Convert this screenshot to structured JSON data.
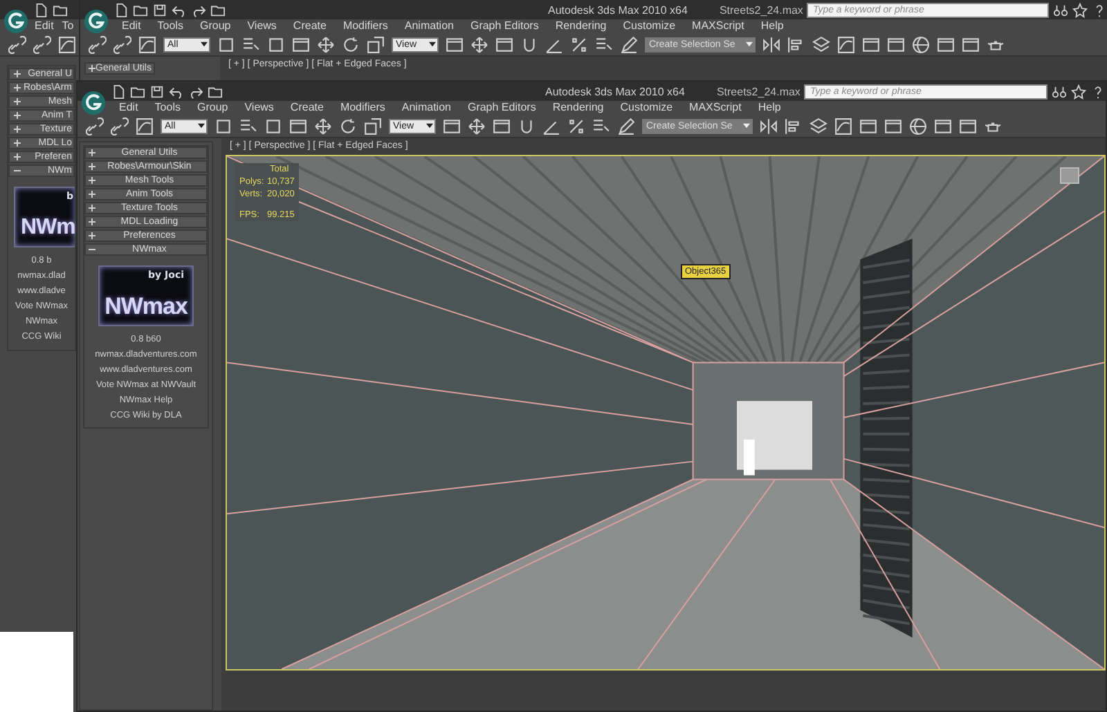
{
  "back_window": {
    "menu": [
      "Edit",
      "To"
    ],
    "rollouts": [
      {
        "label": "General U",
        "expanded": false
      },
      {
        "label": "Robes\\Arm",
        "expanded": false
      },
      {
        "label": "Mesh",
        "expanded": false
      },
      {
        "label": "Anim T",
        "expanded": false
      },
      {
        "label": "Texture",
        "expanded": false
      },
      {
        "label": "MDL Lo",
        "expanded": false
      },
      {
        "label": "Preferen",
        "expanded": false
      },
      {
        "label": "NWm",
        "expanded": true
      }
    ],
    "logo": {
      "title": "NWm",
      "byline": "b"
    },
    "info": [
      "0.8 b",
      "nwmax.dlad",
      "www.dladve",
      "Vote NWmax",
      "NWmax",
      "CCG Wiki"
    ]
  },
  "middle_window": {
    "title": "Autodesk 3ds Max 2010 x64",
    "file": "Streets2_24.max",
    "search": {
      "placeholder": "Type a keyword or phrase"
    },
    "menu": [
      "Edit",
      "Tools",
      "Group",
      "Views",
      "Create",
      "Modifiers",
      "Animation",
      "Graph Editors",
      "Rendering",
      "Customize",
      "MAXScript",
      "Help"
    ],
    "dropdowns": [
      "All",
      "View",
      "Create Selection Se"
    ],
    "rollouts": [
      {
        "label": "General Utils",
        "expanded": false
      }
    ],
    "viewport_label": "[ + ] [ Perspective ] [ Flat + Edged Faces ]"
  },
  "front_window": {
    "title": "Autodesk 3ds Max 2010 x64",
    "file": "Streets2_24.max",
    "search": {
      "placeholder": "Type a keyword or phrase"
    },
    "menu": [
      "Edit",
      "Tools",
      "Group",
      "Views",
      "Create",
      "Modifiers",
      "Animation",
      "Graph Editors",
      "Rendering",
      "Customize",
      "MAXScript",
      "Help"
    ],
    "dropdowns": [
      "All",
      "View",
      "Create Selection Se"
    ],
    "rollouts": [
      {
        "label": "General Utils",
        "expanded": false
      },
      {
        "label": "Robes\\Armour\\Skin",
        "expanded": false
      },
      {
        "label": "Mesh Tools",
        "expanded": false
      },
      {
        "label": "Anim Tools",
        "expanded": false
      },
      {
        "label": "Texture Tools",
        "expanded": false
      },
      {
        "label": "MDL Loading",
        "expanded": false
      },
      {
        "label": "Preferences",
        "expanded": false
      },
      {
        "label": "NWmax",
        "expanded": true
      }
    ],
    "logo": {
      "title": "NWmax",
      "byline": "by Joci"
    },
    "info": [
      "0.8 b60",
      "nwmax.dladventures.com",
      "www.dladventures.com",
      "Vote NWmax at NWVault",
      "NWmax Help",
      "CCG Wiki by DLA"
    ],
    "viewport_label": "[ + ] [ Perspective ] [ Flat + Edged Faces ]",
    "stats": {
      "header": "Total",
      "rows": [
        {
          "label": "Polys:",
          "value": "10,737"
        },
        {
          "label": "Verts:",
          "value": "20,020"
        },
        {
          "label": "FPS:",
          "value": "99.215"
        }
      ]
    },
    "object_label": "Object365"
  }
}
